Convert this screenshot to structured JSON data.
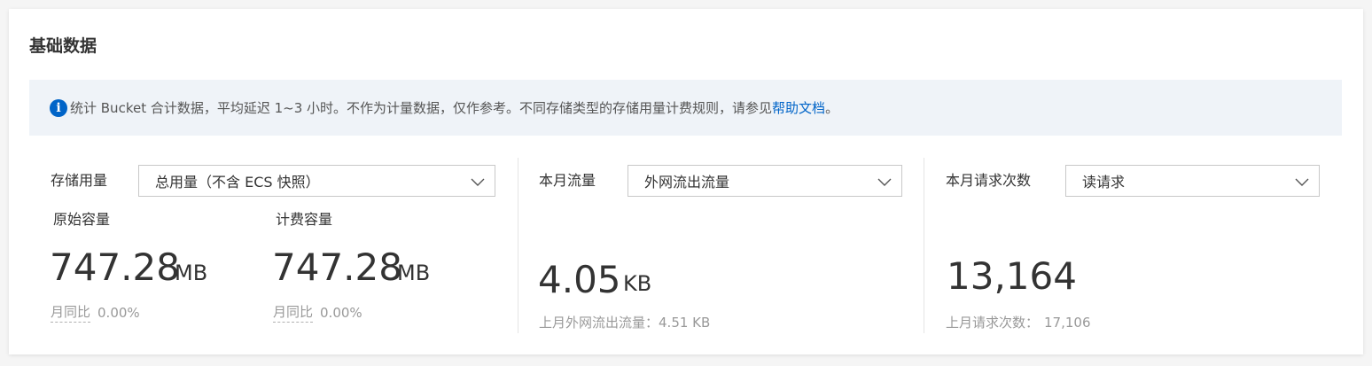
{
  "title": "基础数据",
  "notice": {
    "icon": "info-icon",
    "text": "统计 Bucket 合计数据，平均延迟 1~3 小时。不作为计量数据，仅作参考。不同存储类型的存储用量计费规则，请参见",
    "link": "帮助文档",
    "suffix": "。"
  },
  "storage": {
    "label": "存储用量",
    "select_value": "总用量（不含 ECS 快照）",
    "original": {
      "label": "原始容量",
      "value": "747.28",
      "unit": "MB",
      "compare_label": "月同比",
      "compare_value": "0.00%"
    },
    "billed": {
      "label": "计费容量",
      "value": "747.28",
      "unit": "MB",
      "compare_label": "月同比",
      "compare_value": "0.00%"
    }
  },
  "traffic": {
    "label": "本月流量",
    "select_value": "外网流出流量",
    "value": "4.05",
    "unit": "KB",
    "last_month_label": "上月外网流出流量：",
    "last_month_value": "4.51 KB"
  },
  "requests": {
    "label": "本月请求次数",
    "select_value": "读请求",
    "value": "13,164",
    "last_month_label": "上月请求次数：",
    "last_month_value": "17,106"
  },
  "colors": {
    "accent": "#0064c8",
    "notice_bg": "#eff3f8",
    "muted_text": "#999999"
  }
}
